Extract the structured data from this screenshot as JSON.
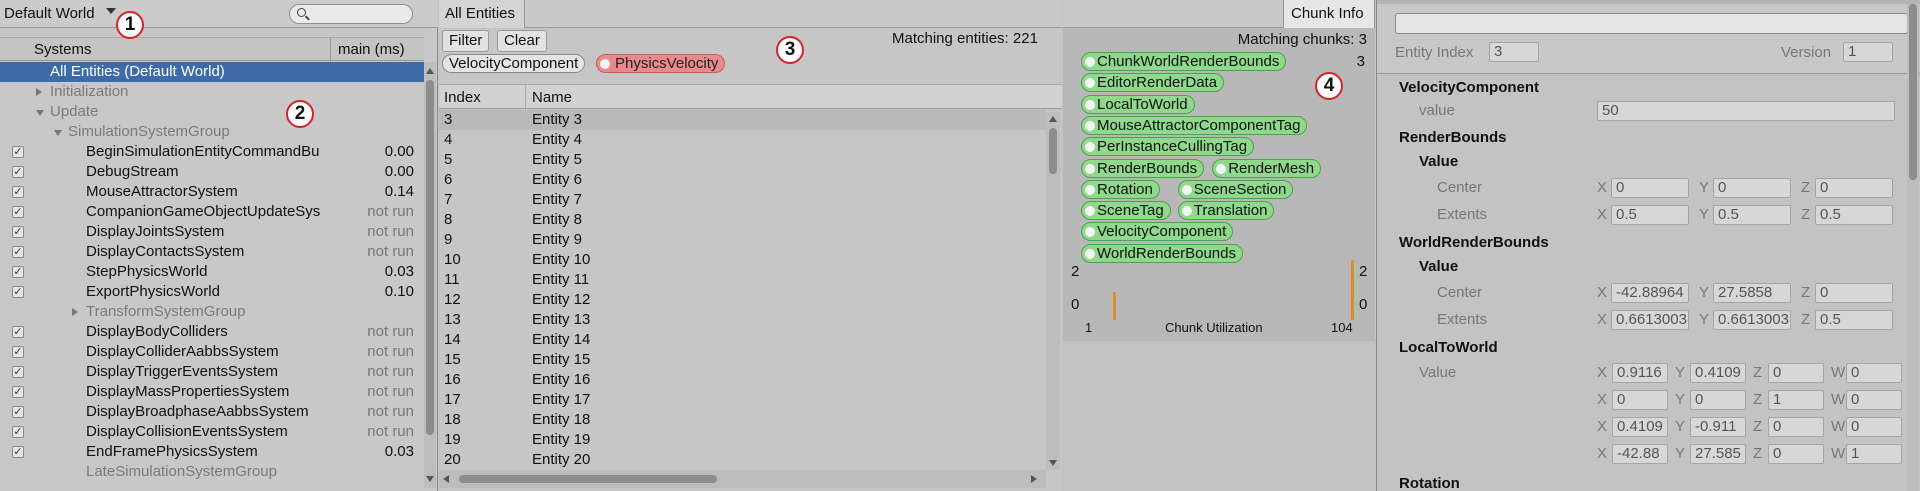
{
  "systems_panel": {
    "world": "Default World",
    "column_systems": "Systems",
    "column_time": "main (ms)",
    "rows": [
      {
        "label": "All Entities (Default World)",
        "value": "",
        "indent": 50,
        "check": false,
        "tri": "",
        "style": "selected"
      },
      {
        "label": "Initialization",
        "value": "",
        "indent": 50,
        "check": false,
        "tri": "r",
        "style": "grey"
      },
      {
        "label": "Update",
        "value": "",
        "indent": 50,
        "check": false,
        "tri": "d",
        "style": "grey"
      },
      {
        "label": "SimulationSystemGroup",
        "value": "",
        "indent": 68,
        "check": false,
        "tri": "d",
        "style": "grey"
      },
      {
        "label": "BeginSimulationEntityCommandBu",
        "value": "0.00",
        "indent": 86,
        "check": true,
        "tri": "",
        "style": ""
      },
      {
        "label": "DebugStream",
        "value": "0.00",
        "indent": 86,
        "check": true,
        "tri": "",
        "style": ""
      },
      {
        "label": "MouseAttractorSystem",
        "value": "0.14",
        "indent": 86,
        "check": true,
        "tri": "",
        "style": ""
      },
      {
        "label": "CompanionGameObjectUpdateSys",
        "value": "not run",
        "indent": 86,
        "check": true,
        "tri": "",
        "style": ""
      },
      {
        "label": "DisplayJointsSystem",
        "value": "not run",
        "indent": 86,
        "check": true,
        "tri": "",
        "style": ""
      },
      {
        "label": "DisplayContactsSystem",
        "value": "not run",
        "indent": 86,
        "check": true,
        "tri": "",
        "style": ""
      },
      {
        "label": "StepPhysicsWorld",
        "value": "0.03",
        "indent": 86,
        "check": true,
        "tri": "",
        "style": ""
      },
      {
        "label": "ExportPhysicsWorld",
        "value": "0.10",
        "indent": 86,
        "check": true,
        "tri": "",
        "style": ""
      },
      {
        "label": "TransformSystemGroup",
        "value": "",
        "indent": 86,
        "check": false,
        "tri": "r",
        "style": "grey"
      },
      {
        "label": "DisplayBodyColliders",
        "value": "not run",
        "indent": 86,
        "check": true,
        "tri": "",
        "style": ""
      },
      {
        "label": "DisplayColliderAabbsSystem",
        "value": "not run",
        "indent": 86,
        "check": true,
        "tri": "",
        "style": ""
      },
      {
        "label": "DisplayTriggerEventsSystem",
        "value": "not run",
        "indent": 86,
        "check": true,
        "tri": "",
        "style": ""
      },
      {
        "label": "DisplayMassPropertiesSystem",
        "value": "not run",
        "indent": 86,
        "check": true,
        "tri": "",
        "style": ""
      },
      {
        "label": "DisplayBroadphaseAabbsSystem",
        "value": "not run",
        "indent": 86,
        "check": true,
        "tri": "",
        "style": ""
      },
      {
        "label": "DisplayCollisionEventsSystem",
        "value": "not run",
        "indent": 86,
        "check": true,
        "tri": "",
        "style": ""
      },
      {
        "label": "EndFramePhysicsSystem",
        "value": "0.03",
        "indent": 86,
        "check": true,
        "tri": "",
        "style": ""
      },
      {
        "label": "LateSimulationSystemGroup",
        "value": "",
        "indent": 86,
        "check": false,
        "tri": "",
        "style": "grey"
      }
    ]
  },
  "entities_panel": {
    "tab": "All Entities",
    "filter_button": "Filter",
    "clear_button": "Clear",
    "matching": "Matching entities: 221",
    "chips": [
      {
        "label": "VelocityComponent",
        "style": "plain"
      },
      {
        "label": "PhysicsVelocity",
        "style": "red"
      }
    ],
    "col_index": "Index",
    "col_name": "Name",
    "rows": [
      {
        "index": "3",
        "name": "Entity 3"
      },
      {
        "index": "4",
        "name": "Entity 4"
      },
      {
        "index": "5",
        "name": "Entity 5"
      },
      {
        "index": "6",
        "name": "Entity 6"
      },
      {
        "index": "7",
        "name": "Entity 7"
      },
      {
        "index": "8",
        "name": "Entity 8"
      },
      {
        "index": "9",
        "name": "Entity 9"
      },
      {
        "index": "10",
        "name": "Entity 10"
      },
      {
        "index": "11",
        "name": "Entity 11"
      },
      {
        "index": "12",
        "name": "Entity 12"
      },
      {
        "index": "13",
        "name": "Entity 13"
      },
      {
        "index": "14",
        "name": "Entity 14"
      },
      {
        "index": "15",
        "name": "Entity 15"
      },
      {
        "index": "16",
        "name": "Entity 16"
      },
      {
        "index": "17",
        "name": "Entity 17"
      },
      {
        "index": "18",
        "name": "Entity 18"
      },
      {
        "index": "19",
        "name": "Entity 19"
      },
      {
        "index": "20",
        "name": "Entity 20"
      }
    ]
  },
  "chunk_panel": {
    "tab": "Chunk Info",
    "matching": "Matching chunks: 3",
    "count": "3",
    "components": [
      [
        "ChunkWorldRenderBounds"
      ],
      [
        "EditorRenderData"
      ],
      [
        "LocalToWorld"
      ],
      [
        "MouseAttractorComponentTag"
      ],
      [
        "PerInstanceCullingTag"
      ],
      [
        "RenderBounds",
        "RenderMesh"
      ],
      [
        "Rotation",
        "SceneSection"
      ],
      [
        "SceneTag",
        "Translation"
      ],
      [
        "VelocityComponent"
      ],
      [
        "WorldRenderBounds"
      ]
    ],
    "chart": {
      "y_max_left": "2",
      "y_min_left": "0",
      "y_max_right": "2",
      "y_min_right": "0",
      "x_min": "1",
      "x_max": "104",
      "caption": "Chunk Utilization",
      "bar_color": "#d8902a"
    }
  },
  "inspector": {
    "entity_index_label": "Entity Index",
    "entity_index": "3",
    "version_label": "Version",
    "version": "1",
    "velocity_title": "VelocityComponent",
    "velocity_value_label": "value",
    "velocity_value": "50",
    "render_bounds_title": "RenderBounds",
    "value_label": "Value",
    "center_label": "Center",
    "extents_label": "Extents",
    "rb_center": [
      "0",
      "0",
      "0"
    ],
    "rb_extents": [
      "0.5",
      "0.5",
      "0.5"
    ],
    "world_render_bounds_title": "WorldRenderBounds",
    "wrb_center": [
      "-42.88964",
      "27.5858",
      "0"
    ],
    "wrb_extents": [
      "0.6613003",
      "0.6613003",
      "0.5"
    ],
    "local_to_world_title": "LocalToWorld",
    "ltw_value_label": "Value",
    "ltw_rows": [
      [
        "0.9116",
        "0.4109",
        "0",
        "0"
      ],
      [
        "0",
        "0",
        "1",
        "0"
      ],
      [
        "0.4109",
        "-0.911",
        "0",
        "0"
      ],
      [
        "-42.88",
        "27.585",
        "0",
        "1"
      ]
    ],
    "rotation_title": "Rotation",
    "axes": [
      "X",
      "Y",
      "Z",
      "W"
    ]
  },
  "annotations": [
    "1",
    "2",
    "3",
    "4"
  ],
  "colors": {
    "selection": "#3e6ba7",
    "marker": "#d4232a",
    "chip_green": "#8fd88c",
    "chip_red": "#e98a8a"
  }
}
